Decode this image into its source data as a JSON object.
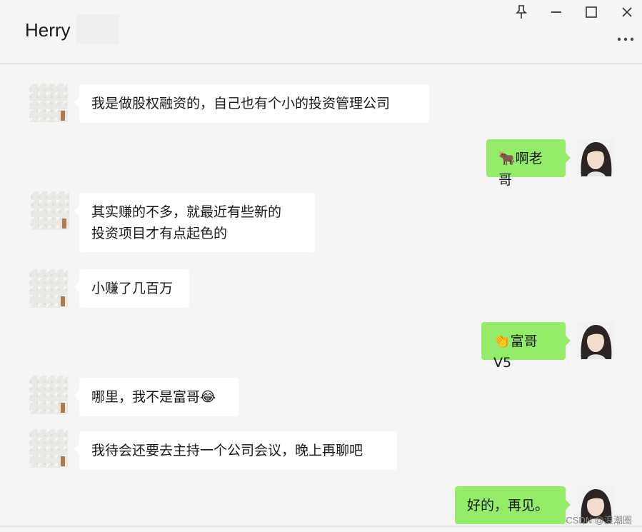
{
  "header": {
    "title": "Herry",
    "pin_icon": "pin-icon",
    "minimize_icon": "minimize-icon",
    "maximize_icon": "maximize-icon",
    "close_icon": "close-icon",
    "more_icon": "more-icon"
  },
  "messages": [
    {
      "side": "left",
      "text": "我是做股权融资的，自己也有个小的投资管理公司"
    },
    {
      "side": "right",
      "text": "🐂啊老哥"
    },
    {
      "side": "left",
      "text": "其实赚的不多，就最近有些新的\n投资项目才有点起色的"
    },
    {
      "side": "left",
      "text": "小赚了几百万"
    },
    {
      "side": "right",
      "text": "👏富哥V5"
    },
    {
      "side": "left",
      "text": "哪里，我不是富哥😂"
    },
    {
      "side": "left",
      "text": "我待会还要去主持一个公司会议，晚上再聊吧"
    },
    {
      "side": "right",
      "text": "好的，再见。"
    }
  ],
  "watermark": "CSDN @浪潮圈",
  "colors": {
    "background": "#f5f5f5",
    "self_bubble": "#95ec69",
    "other_bubble": "#ffffff"
  }
}
